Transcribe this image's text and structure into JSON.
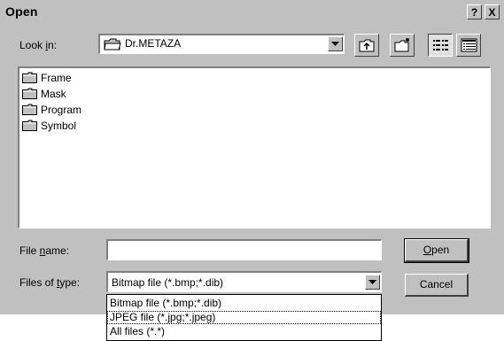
{
  "window": {
    "title": "Open",
    "help": "?",
    "close": "X"
  },
  "look_in": {
    "label_pre": "Look ",
    "label_u": "i",
    "label_post": "n:",
    "value": "Dr.METAZA"
  },
  "files": [
    {
      "name": "Frame",
      "icon": "folder-icon"
    },
    {
      "name": "Mask",
      "icon": "folder-icon"
    },
    {
      "name": "Program",
      "icon": "folder-icon"
    },
    {
      "name": "Symbol",
      "icon": "folder-icon"
    }
  ],
  "file_name": {
    "label_pre": "File ",
    "label_u": "n",
    "label_post": "ame:",
    "value": ""
  },
  "file_type": {
    "label_pre": "Files of ",
    "label_u": "t",
    "label_post": "ype:",
    "value": "Bitmap file (*.bmp;*.dib)",
    "options": [
      "Bitmap file (*.bmp;*.dib)",
      "JPEG file (*.jpg;*.jpeg)",
      "All files (*.*)"
    ]
  },
  "buttons": {
    "open_u": "O",
    "open_rest": "pen",
    "cancel": "Cancel"
  }
}
